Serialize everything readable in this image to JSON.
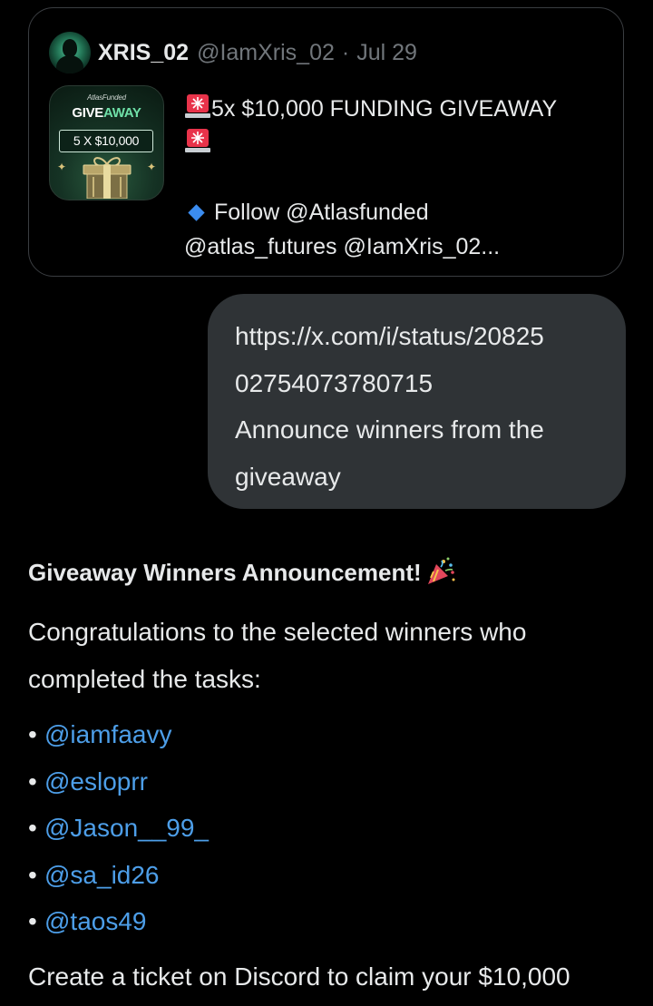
{
  "quote": {
    "author_name": "XRIS_02",
    "author_handle": "@IamXris_02",
    "separator": "·",
    "date": "Jul 29",
    "avatar_icon": "person-silhouette-avatar",
    "thumbnail": {
      "brand": "AtlasFunded",
      "title_prefix": "GIVE",
      "title_accent": "AWAY",
      "badge": "5 X $10,000",
      "icon": "gift-box-icon"
    },
    "headline": "5x $10,000 FUNDING GIVEAWAY",
    "follow_line": "Follow @Atlasfunded",
    "mentions_line": "@atlas_futures @IamXris_02..."
  },
  "user_message": {
    "lines": [
      "https://x.com/i/status/20825",
      "02754073780715",
      "Announce winners from the",
      "giveaway"
    ]
  },
  "response": {
    "heading": "Giveaway Winners Announcement!",
    "intro_lines": [
      "Congratulations to the selected winners who",
      "completed the tasks:"
    ],
    "bullet": "•",
    "winners": [
      "@iamfaavy",
      "@esloprr",
      "@Jason__99_",
      "@sa_id26",
      "@taos49"
    ],
    "footer": "Create a ticket on Discord to claim your $10,000"
  },
  "colors": {
    "background": "#000000",
    "text": "#e7e9ea",
    "muted": "#71767b",
    "bubble": "#2f3336",
    "card_border": "#3a3d41",
    "link": "#4d9ee8",
    "diamond": "#3b8cf0",
    "siren": "#e8334a"
  }
}
